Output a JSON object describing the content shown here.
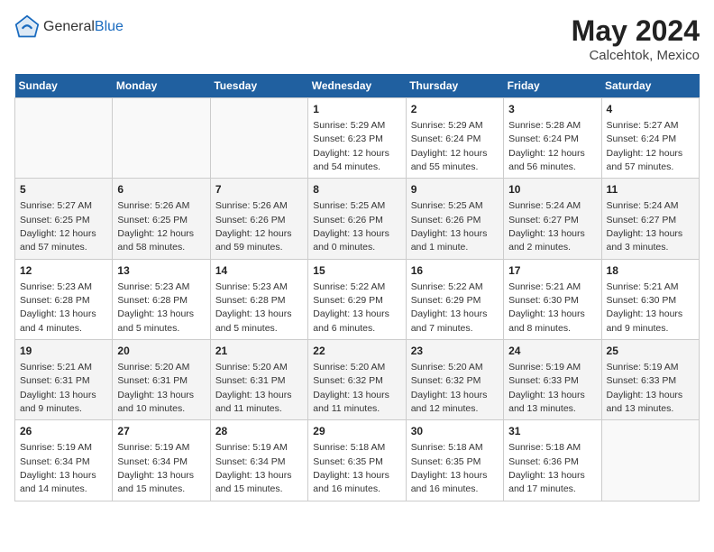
{
  "header": {
    "logo_general": "General",
    "logo_blue": "Blue",
    "month_title": "May 2024",
    "location": "Calcehtok, Mexico"
  },
  "weekdays": [
    "Sunday",
    "Monday",
    "Tuesday",
    "Wednesday",
    "Thursday",
    "Friday",
    "Saturday"
  ],
  "weeks": [
    [
      {
        "day": "",
        "info": ""
      },
      {
        "day": "",
        "info": ""
      },
      {
        "day": "",
        "info": ""
      },
      {
        "day": "1",
        "info": "Sunrise: 5:29 AM\nSunset: 6:23 PM\nDaylight: 12 hours\nand 54 minutes."
      },
      {
        "day": "2",
        "info": "Sunrise: 5:29 AM\nSunset: 6:24 PM\nDaylight: 12 hours\nand 55 minutes."
      },
      {
        "day": "3",
        "info": "Sunrise: 5:28 AM\nSunset: 6:24 PM\nDaylight: 12 hours\nand 56 minutes."
      },
      {
        "day": "4",
        "info": "Sunrise: 5:27 AM\nSunset: 6:24 PM\nDaylight: 12 hours\nand 57 minutes."
      }
    ],
    [
      {
        "day": "5",
        "info": "Sunrise: 5:27 AM\nSunset: 6:25 PM\nDaylight: 12 hours\nand 57 minutes."
      },
      {
        "day": "6",
        "info": "Sunrise: 5:26 AM\nSunset: 6:25 PM\nDaylight: 12 hours\nand 58 minutes."
      },
      {
        "day": "7",
        "info": "Sunrise: 5:26 AM\nSunset: 6:26 PM\nDaylight: 12 hours\nand 59 minutes."
      },
      {
        "day": "8",
        "info": "Sunrise: 5:25 AM\nSunset: 6:26 PM\nDaylight: 13 hours\nand 0 minutes."
      },
      {
        "day": "9",
        "info": "Sunrise: 5:25 AM\nSunset: 6:26 PM\nDaylight: 13 hours\nand 1 minute."
      },
      {
        "day": "10",
        "info": "Sunrise: 5:24 AM\nSunset: 6:27 PM\nDaylight: 13 hours\nand 2 minutes."
      },
      {
        "day": "11",
        "info": "Sunrise: 5:24 AM\nSunset: 6:27 PM\nDaylight: 13 hours\nand 3 minutes."
      }
    ],
    [
      {
        "day": "12",
        "info": "Sunrise: 5:23 AM\nSunset: 6:28 PM\nDaylight: 13 hours\nand 4 minutes."
      },
      {
        "day": "13",
        "info": "Sunrise: 5:23 AM\nSunset: 6:28 PM\nDaylight: 13 hours\nand 5 minutes."
      },
      {
        "day": "14",
        "info": "Sunrise: 5:23 AM\nSunset: 6:28 PM\nDaylight: 13 hours\nand 5 minutes."
      },
      {
        "day": "15",
        "info": "Sunrise: 5:22 AM\nSunset: 6:29 PM\nDaylight: 13 hours\nand 6 minutes."
      },
      {
        "day": "16",
        "info": "Sunrise: 5:22 AM\nSunset: 6:29 PM\nDaylight: 13 hours\nand 7 minutes."
      },
      {
        "day": "17",
        "info": "Sunrise: 5:21 AM\nSunset: 6:30 PM\nDaylight: 13 hours\nand 8 minutes."
      },
      {
        "day": "18",
        "info": "Sunrise: 5:21 AM\nSunset: 6:30 PM\nDaylight: 13 hours\nand 9 minutes."
      }
    ],
    [
      {
        "day": "19",
        "info": "Sunrise: 5:21 AM\nSunset: 6:31 PM\nDaylight: 13 hours\nand 9 minutes."
      },
      {
        "day": "20",
        "info": "Sunrise: 5:20 AM\nSunset: 6:31 PM\nDaylight: 13 hours\nand 10 minutes."
      },
      {
        "day": "21",
        "info": "Sunrise: 5:20 AM\nSunset: 6:31 PM\nDaylight: 13 hours\nand 11 minutes."
      },
      {
        "day": "22",
        "info": "Sunrise: 5:20 AM\nSunset: 6:32 PM\nDaylight: 13 hours\nand 11 minutes."
      },
      {
        "day": "23",
        "info": "Sunrise: 5:20 AM\nSunset: 6:32 PM\nDaylight: 13 hours\nand 12 minutes."
      },
      {
        "day": "24",
        "info": "Sunrise: 5:19 AM\nSunset: 6:33 PM\nDaylight: 13 hours\nand 13 minutes."
      },
      {
        "day": "25",
        "info": "Sunrise: 5:19 AM\nSunset: 6:33 PM\nDaylight: 13 hours\nand 13 minutes."
      }
    ],
    [
      {
        "day": "26",
        "info": "Sunrise: 5:19 AM\nSunset: 6:34 PM\nDaylight: 13 hours\nand 14 minutes."
      },
      {
        "day": "27",
        "info": "Sunrise: 5:19 AM\nSunset: 6:34 PM\nDaylight: 13 hours\nand 15 minutes."
      },
      {
        "day": "28",
        "info": "Sunrise: 5:19 AM\nSunset: 6:34 PM\nDaylight: 13 hours\nand 15 minutes."
      },
      {
        "day": "29",
        "info": "Sunrise: 5:18 AM\nSunset: 6:35 PM\nDaylight: 13 hours\nand 16 minutes."
      },
      {
        "day": "30",
        "info": "Sunrise: 5:18 AM\nSunset: 6:35 PM\nDaylight: 13 hours\nand 16 minutes."
      },
      {
        "day": "31",
        "info": "Sunrise: 5:18 AM\nSunset: 6:36 PM\nDaylight: 13 hours\nand 17 minutes."
      },
      {
        "day": "",
        "info": ""
      }
    ]
  ]
}
